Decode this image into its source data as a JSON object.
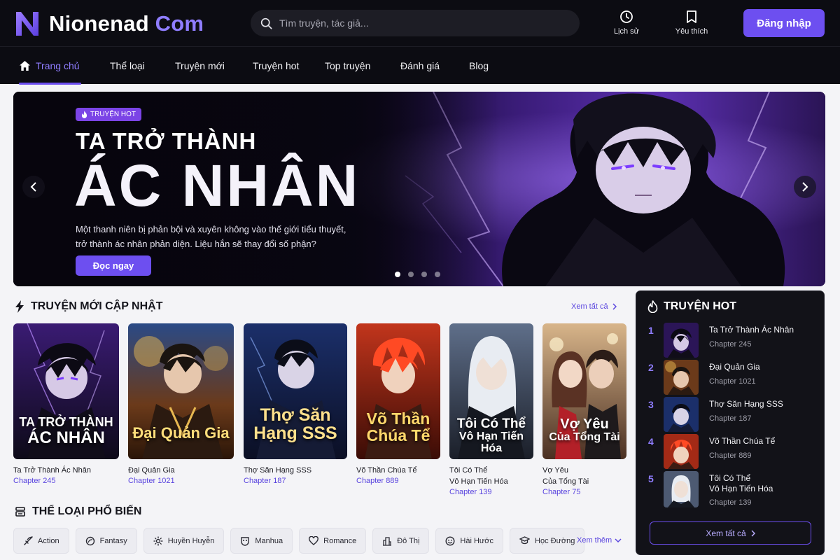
{
  "brand": {
    "name_main": "Nionenad",
    "name_accent": "Com"
  },
  "search": {
    "placeholder": "Tìm truyện, tác giả..."
  },
  "header": {
    "history_label": "Lịch sử",
    "favorites_label": "Yêu thích",
    "login_label": "Đăng nhập"
  },
  "nav": {
    "items": [
      {
        "label": "Trang chủ",
        "active": true
      },
      {
        "label": "Thể loại"
      },
      {
        "label": "Truyện mới"
      },
      {
        "label": "Truyện hot"
      },
      {
        "label": "Top truyện"
      },
      {
        "label": "Đánh giá"
      },
      {
        "label": "Blog"
      }
    ]
  },
  "hero": {
    "badge": "TRUYỆN HOT",
    "title_line1": "TA TRỞ THÀNH",
    "title_line2": "ÁC NHÂN",
    "description_line1": "Một thanh niên bị phản bội và xuyên không vào thế giới tiểu thuyết,",
    "description_line2": "trở thành ác nhân phản diện. Liệu hắn sẽ thay đổi số phận?",
    "cta_label": "Đọc ngay",
    "slide_count": 4,
    "active_slide": 1
  },
  "new_updates": {
    "title": "TRUYỆN MỚI CẬP NHẬT",
    "see_all_label": "Xem tất cả",
    "cards": [
      {
        "cover_line1": "TA TRỞ THÀNH",
        "cover_line2": "ÁC NHÂN",
        "title": "Ta Trở Thành Ác Nhân",
        "title_line2": "",
        "chapter": "Chapter 245"
      },
      {
        "cover_line1": "Đại Quản Gia",
        "cover_line2": "",
        "title": "Đại Quản Gia",
        "title_line2": "",
        "chapter": "Chapter 1021"
      },
      {
        "cover_line1": "Thợ Săn",
        "cover_line2": "Hạng SSS",
        "title": "Thợ Săn Hạng SSS",
        "title_line2": "",
        "chapter": "Chapter 187"
      },
      {
        "cover_line1": "Võ Thần",
        "cover_line2": "Chúa Tể",
        "title": "Võ Thần Chúa Tể",
        "title_line2": "",
        "chapter": "Chapter 889"
      },
      {
        "cover_line1": "Tôi Có Thể",
        "cover_line2": "Vô Hạn Tiến Hóa",
        "title": "Tôi Có Thể",
        "title_line2": "Vô Hạn Tiến Hóa",
        "chapter": "Chapter 139"
      },
      {
        "cover_line1": "Vợ Yêu",
        "cover_line2": "Của Tổng Tài",
        "title": "Vợ Yêu",
        "title_line2": "Của Tổng Tài",
        "chapter": "Chapter 75"
      }
    ]
  },
  "genres": {
    "title": "THỂ LOẠI PHỔ BIẾN",
    "items": [
      {
        "label": "Action",
        "icon": "sword-icon"
      },
      {
        "label": "Fantasy",
        "icon": "magic-icon"
      },
      {
        "label": "Huyền Huyễn",
        "icon": "sparkle-icon"
      },
      {
        "label": "Manhua",
        "icon": "mask-icon"
      },
      {
        "label": "Romance",
        "icon": "heart-icon"
      },
      {
        "label": "Đô Thị",
        "icon": "city-icon"
      },
      {
        "label": "Hài Hước",
        "icon": "smile-icon"
      },
      {
        "label": "Học Đường",
        "icon": "graduation-cap-icon"
      }
    ],
    "more_label": "Xem thêm"
  },
  "hot": {
    "title": "TRUYỆN HOT",
    "items": [
      {
        "rank": "1",
        "name": "Ta Trở Thành Ác Nhân",
        "name_line2": "",
        "chapter": "Chapter 245"
      },
      {
        "rank": "2",
        "name": "Đại Quản Gia",
        "name_line2": "",
        "chapter": "Chapter 1021"
      },
      {
        "rank": "3",
        "name": "Thợ Săn Hạng SSS",
        "name_line2": "",
        "chapter": "Chapter 187"
      },
      {
        "rank": "4",
        "name": "Võ Thần Chúa Tể",
        "name_line2": "",
        "chapter": "Chapter 889"
      },
      {
        "rank": "5",
        "name": "Tôi Có Thể",
        "name_line2": "Vô Hạn Tiến Hóa",
        "chapter": "Chapter 139"
      }
    ],
    "see_all_label": "Xem tất cả"
  },
  "colors": {
    "accent": "#6d4ff0",
    "accent_light": "#8f7dff",
    "header_bg": "#0c0c12",
    "panel_bg": "#121218"
  }
}
